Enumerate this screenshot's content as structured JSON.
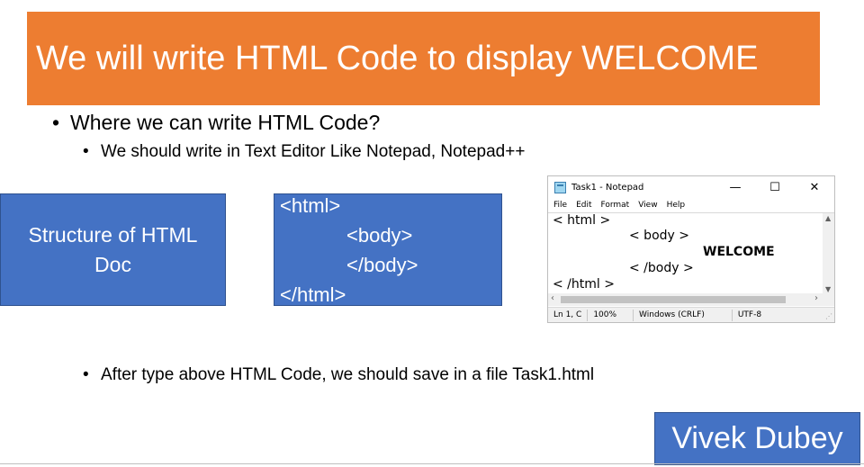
{
  "slide": {
    "title": "We will write HTML Code to display WELCOME",
    "bullet_question": "Where we can write HTML Code?",
    "bullet_answer": "We should write in Text Editor Like Notepad, Notepad++",
    "bullet_save": "After type above HTML Code, we should save in a file Task1.html",
    "structure_box": "Structure of HTML Doc",
    "code_lines": [
      "<html>",
      "<body>",
      "</body>",
      "</html>"
    ],
    "author": "Vivek Dubey"
  },
  "notepad": {
    "title": "Task1 - Notepad",
    "controls": {
      "minimize": "—",
      "maximize": "☐",
      "close": "✕"
    },
    "menu": [
      "File",
      "Edit",
      "Format",
      "View",
      "Help"
    ],
    "content": {
      "line1": "< html >",
      "line2": "< body >",
      "welcome": "WELCOME",
      "line3": "< /body >",
      "line4": "< /html >"
    },
    "status": [
      "Ln 1, C",
      "100%",
      "Windows (CRLF)",
      "UTF-8"
    ]
  },
  "colors": {
    "title_bg": "#ed7d31",
    "box_bg": "#4472c4"
  }
}
